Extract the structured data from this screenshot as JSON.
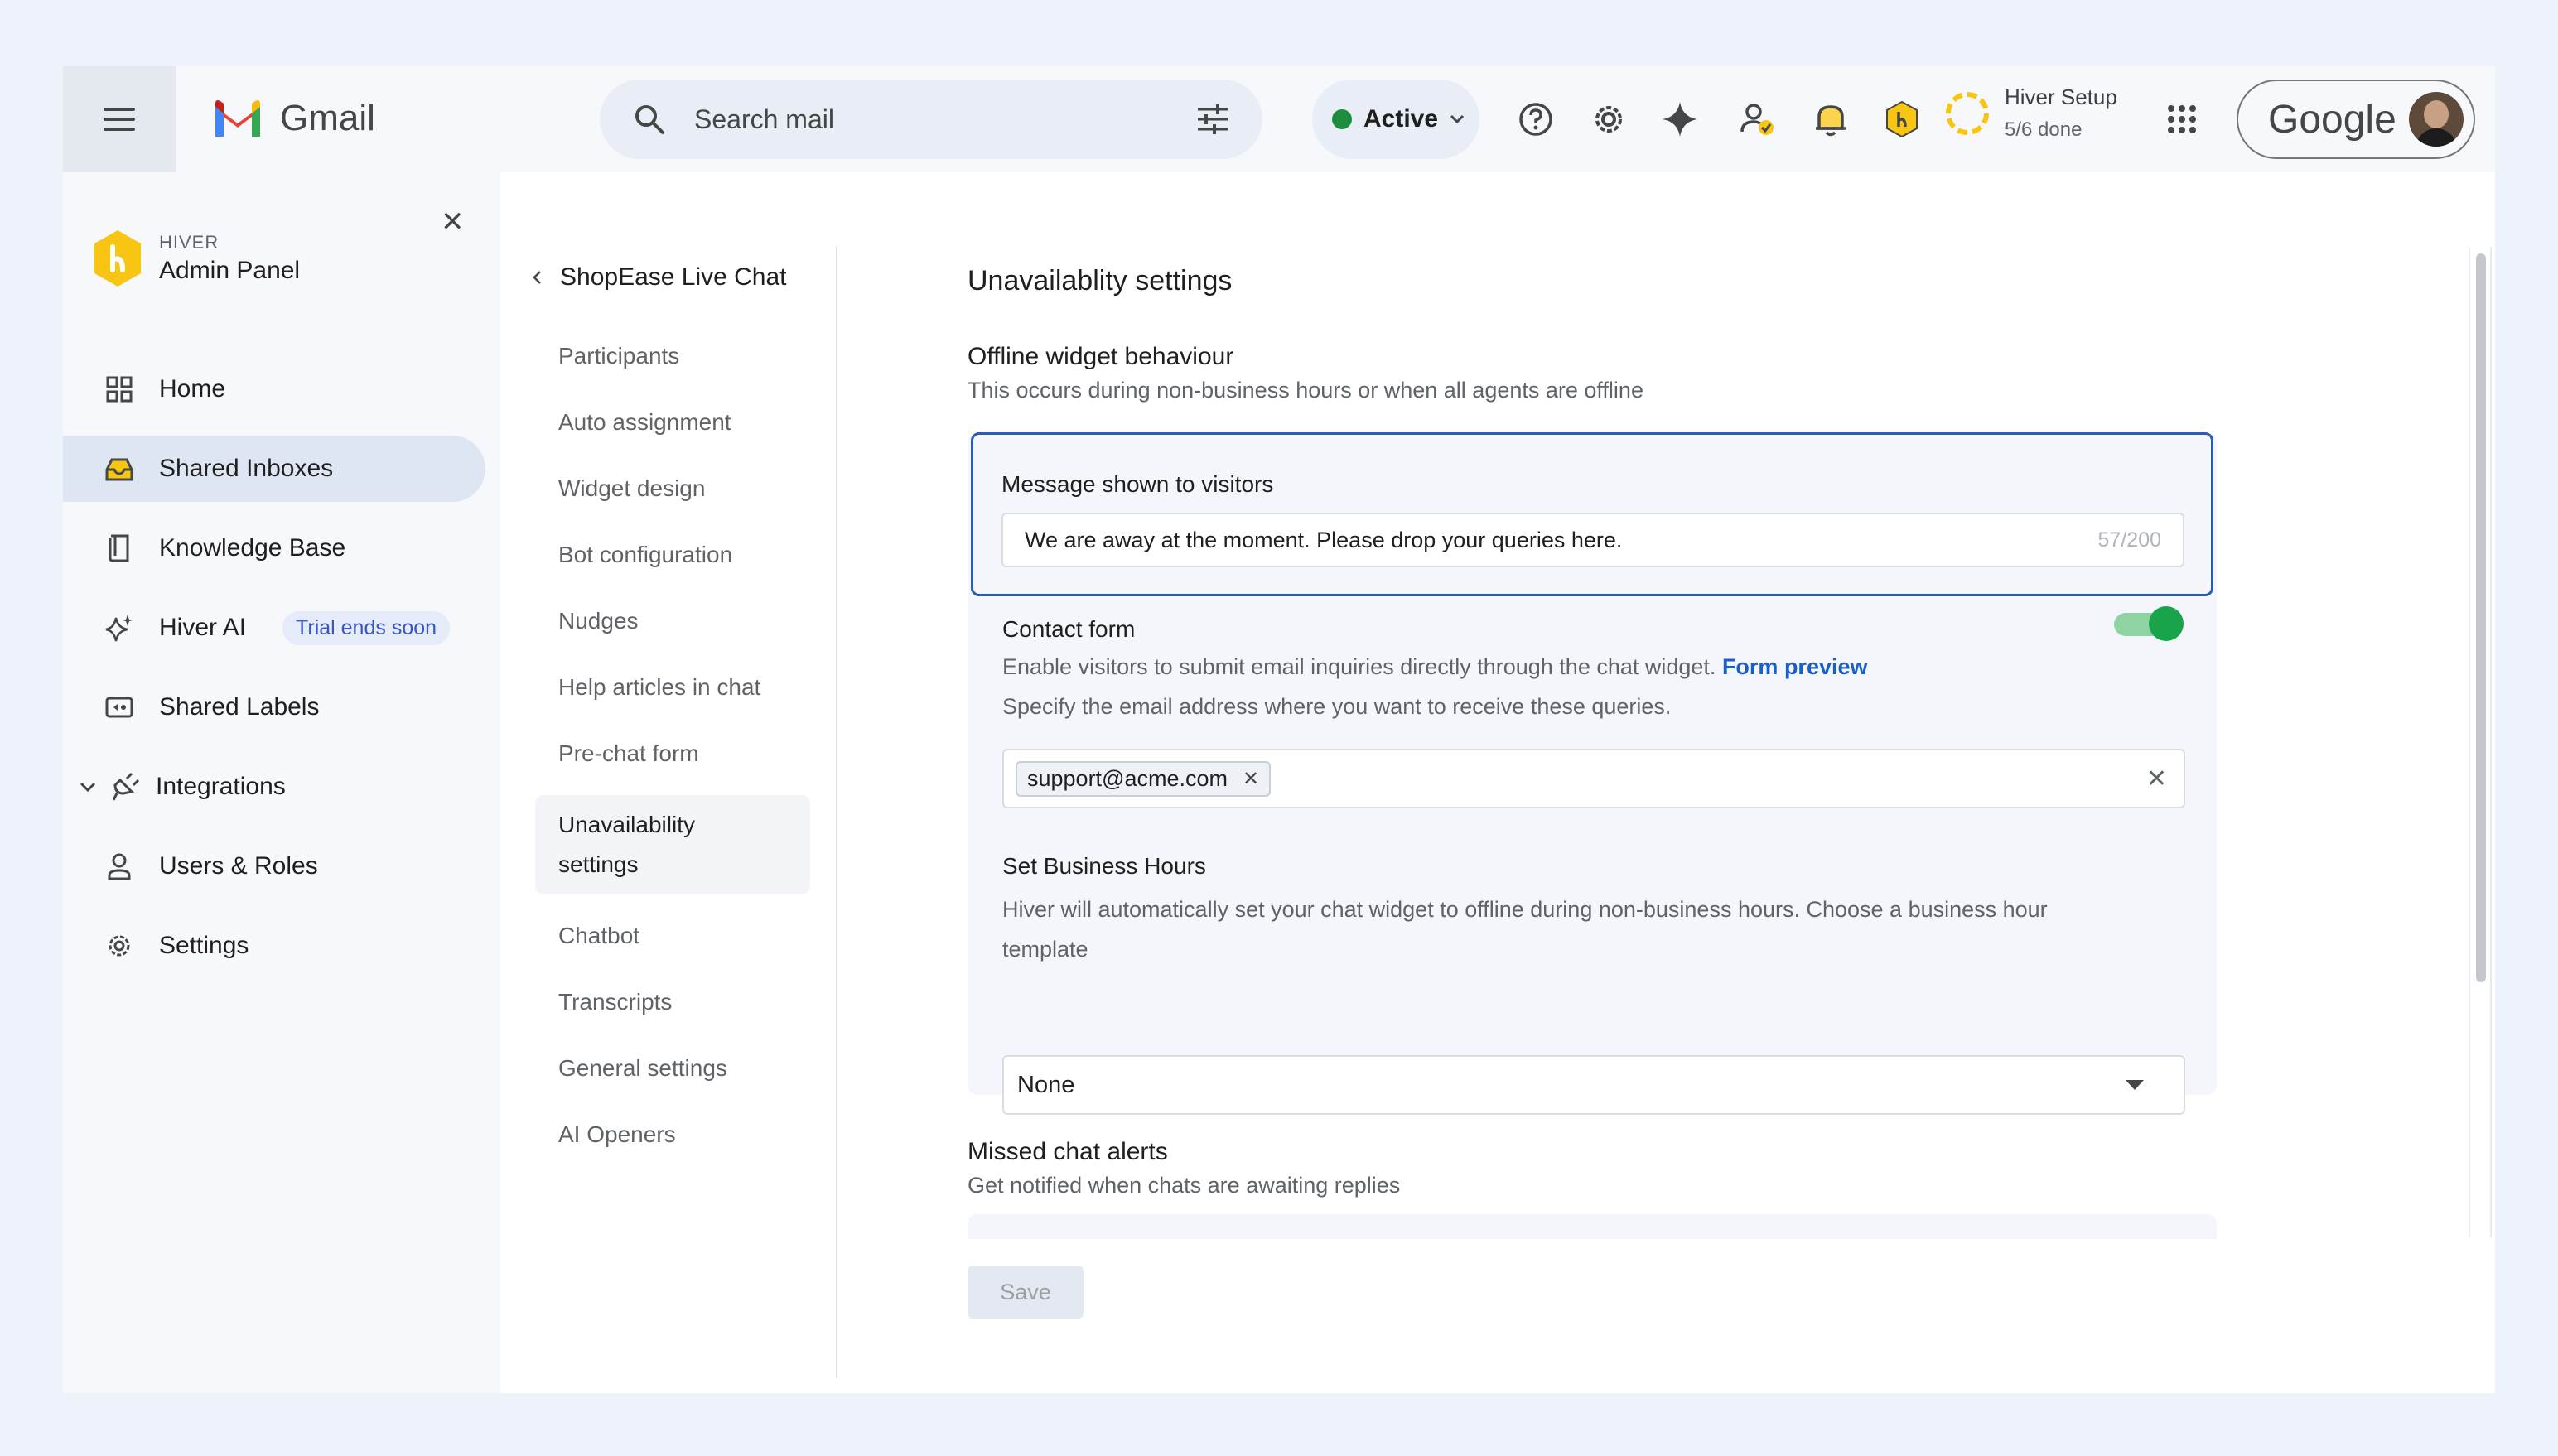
{
  "topbar": {
    "app_name": "Gmail",
    "search_placeholder": "Search mail",
    "status_label": "Active",
    "setup_title": "Hiver Setup",
    "setup_progress": "5/6 done",
    "google_label": "Google",
    "status_color": "#1e8e3e"
  },
  "admin": {
    "brand_small": "HIVER",
    "brand_title": "Admin Panel",
    "nav": [
      {
        "label": "Home",
        "icon": "grid-icon"
      },
      {
        "label": "Shared Inboxes",
        "icon": "inbox-icon"
      },
      {
        "label": "Knowledge Base",
        "icon": "book-icon"
      },
      {
        "label": "Hiver AI",
        "icon": "sparkle-icon",
        "badge": "Trial ends soon"
      },
      {
        "label": "Shared Labels",
        "icon": "label-icon"
      },
      {
        "label": "Integrations",
        "icon": "plug-icon"
      },
      {
        "label": "Users & Roles",
        "icon": "person-icon"
      },
      {
        "label": "Settings",
        "icon": "gear-icon"
      }
    ],
    "selected": "Shared Inboxes"
  },
  "subnav": {
    "back_label": "ShopEase Live Chat",
    "items": [
      "Participants",
      "Auto assignment",
      "Widget design",
      "Bot configuration",
      "Nudges",
      "Help articles in chat",
      "Pre-chat form",
      "Unavailability settings",
      "Chatbot",
      "Transcripts",
      "General settings",
      "AI Openers"
    ],
    "selected": "Unavailability settings",
    "selected_line1": "Unavailability",
    "selected_line2": "settings"
  },
  "main": {
    "title": "Unavailablity settings",
    "offline_title": "Offline widget behaviour",
    "offline_desc": "This occurs during non-business hours or when all agents are offline",
    "message_label": "Message shown to visitors",
    "message_value": "We are away at the moment. Please drop your queries here.",
    "message_count": "57/200",
    "contact_title": "Contact form",
    "contact_enabled": true,
    "contact_desc": "Enable visitors to submit email inquiries directly through the chat widget.",
    "form_preview_link": "Form preview",
    "contact_desc2": "Specify the email address where you want to receive these queries.",
    "email_chip": "support@acme.com",
    "hours_title": "Set Business Hours",
    "hours_desc_line1": "Hiver will automatically set your chat widget to offline during non-business hours. Choose a business hour",
    "hours_desc_line2": "template",
    "hours_value": "None",
    "missed_title": "Missed chat alerts",
    "missed_desc": "Get notified when chats are awaiting replies",
    "save_label": "Save"
  }
}
